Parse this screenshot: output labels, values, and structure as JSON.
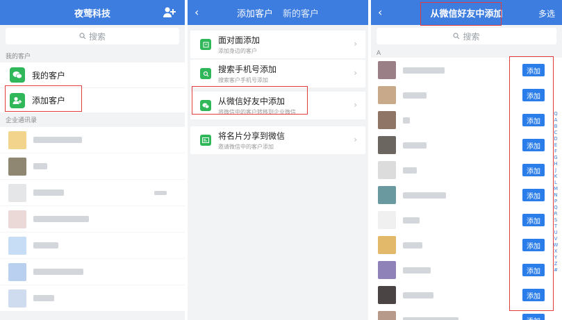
{
  "left": {
    "title": "夜莺科技",
    "search_placeholder": "搜索",
    "section_my": "我的客户",
    "my_customers": "我的客户",
    "add_customer": "添加客户",
    "section_org": "企业通讯录"
  },
  "middle": {
    "tab_add": "添加客户",
    "tab_new": "新的客户",
    "items": [
      {
        "title": "面对面添加",
        "sub": "添加身边的客户"
      },
      {
        "title": "搜索手机号添加",
        "sub": "搜索客户手机号添加"
      },
      {
        "title": "从微信好友中添加",
        "sub": "将微信中的客户转移到企业微信"
      },
      {
        "title": "将名片分享到微信",
        "sub": "邀请微信中的客户添加"
      }
    ]
  },
  "right": {
    "title": "从微信好友中添加",
    "multi_select": "多选",
    "search_placeholder": "搜索",
    "section_a": "A",
    "add_label": "添加",
    "index_letters": "Q A B C D E F G H J K L M N P Q R S T U V W X Y Z #"
  },
  "colors": {
    "header": "#3d7de0",
    "green": "#2fb75a",
    "button": "#2b7de9",
    "highlight": "#e23b3b"
  }
}
